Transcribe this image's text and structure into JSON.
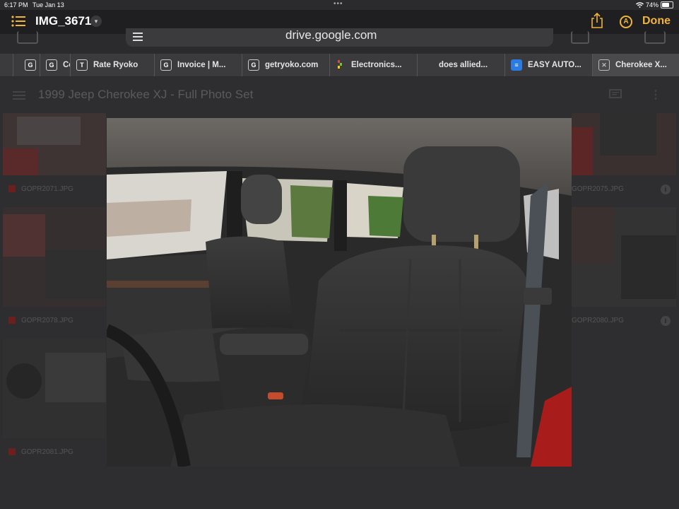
{
  "status_bar": {
    "time": "6:17 PM",
    "date": "Tue Jan 13",
    "battery": "74%",
    "battery_level": 0.74
  },
  "quicklook": {
    "title": "IMG_3671",
    "done_label": "Done"
  },
  "browser": {
    "url": "drive.google.com"
  },
  "tabs": [
    {
      "label": "Co",
      "favicon": "G"
    },
    {
      "label": "Rate Ryoko",
      "favicon": "T"
    },
    {
      "label": "Invoice | M...",
      "favicon": "G"
    },
    {
      "label": "getryoko.com",
      "favicon": "G"
    },
    {
      "label": "Electronics...",
      "favicon": "dots"
    },
    {
      "label": "does allied...",
      "favicon": ""
    },
    {
      "label": "EASY AUTO...",
      "favicon": "e"
    },
    {
      "label": "Cherokee X...",
      "favicon": "close",
      "active": true
    }
  ],
  "drive": {
    "folder_title": "1999 Jeep Cherokee XJ - Full Photo Set",
    "files": [
      "GOPR2071.JPG",
      "GOPR2075.JPG",
      "GOPR2078.JPG",
      "GOPR2080.JPG",
      "GOPR2081.JPG"
    ]
  },
  "colors": {
    "accent": "#f1b43a",
    "background": "#2b2b2d",
    "tab_bar": "#3b3b3d"
  }
}
